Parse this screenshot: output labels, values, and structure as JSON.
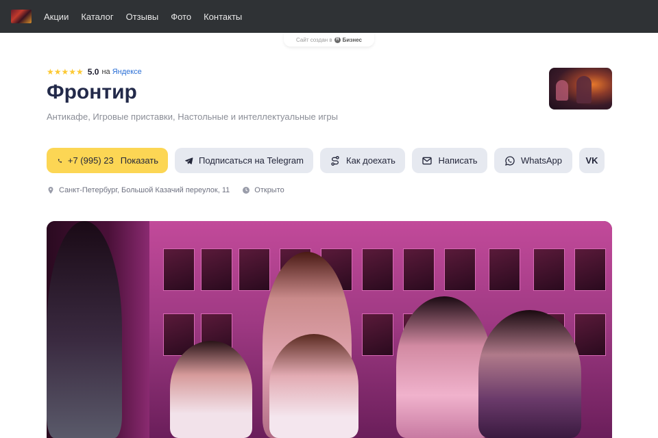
{
  "nav": {
    "items": [
      {
        "label": "Акции"
      },
      {
        "label": "Каталог"
      },
      {
        "label": "Отзывы"
      },
      {
        "label": "Фото"
      },
      {
        "label": "Контакты"
      }
    ]
  },
  "created_badge": {
    "text": "Сайт создан в",
    "brand": "Бизнес",
    "y_letter": "Я"
  },
  "rating": {
    "stars": "★★★★★",
    "value": "5.0",
    "on": "на",
    "source": "Яндексе",
    "star_color": "#fcc934"
  },
  "business": {
    "name": "Фронтир",
    "categories": "Антикафе, Игровые приставки, Настольные и интеллектуальные игры"
  },
  "buttons": {
    "phone_number": "+7 (995) 23",
    "phone_show": "Показать",
    "telegram": "Подписаться на Telegram",
    "route": "Как доехать",
    "write": "Написать",
    "whatsapp": "WhatsApp",
    "vk": "VK"
  },
  "meta": {
    "address": "Санкт-Петербург, Большой Казачий переулок, 11",
    "status": "Открыто"
  },
  "colors": {
    "topbar": "#2f3235",
    "phone_button": "#fcd654",
    "secondary_button": "#e6e9f0",
    "title": "#232a4a"
  }
}
